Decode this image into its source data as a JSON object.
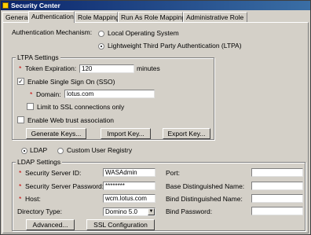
{
  "window": {
    "title": "Security Center"
  },
  "tabs": [
    {
      "label": "General"
    },
    {
      "label": "Authentication"
    },
    {
      "label": "Role Mapping"
    },
    {
      "label": "Run As Role Mapping"
    },
    {
      "label": "Administrative Role"
    }
  ],
  "auth": {
    "label": "Authentication Mechanism:",
    "options": [
      {
        "label": "Local Operating System",
        "selected": false
      },
      {
        "label": "Lightweight Third Party Authentication (LTPA)",
        "selected": true
      }
    ]
  },
  "ltpa": {
    "title": "LTPA Settings",
    "token_label": "Token Expiration:",
    "token_value": "120",
    "token_unit": "minutes",
    "sso_label": "Enable Single Sign On (SSO)",
    "sso_checked": true,
    "domain_label": "Domain:",
    "domain_value": "lotus.com",
    "ssl_label": "Limit to SSL connections only",
    "ssl_checked": false,
    "webtrust_label": "Enable Web trust association",
    "webtrust_checked": false,
    "buttons": {
      "generate": "Generate Keys...",
      "import": "Import Key...",
      "export": "Export Key..."
    }
  },
  "registry": {
    "options": [
      {
        "label": "LDAP",
        "selected": true
      },
      {
        "label": "Custom User Registry",
        "selected": false
      }
    ]
  },
  "ldap": {
    "title": "LDAP Settings",
    "server_id_label": "Security Server ID:",
    "server_id_value": "WASAdmin",
    "password_label": "Security Server Password:",
    "password_value": "********",
    "host_label": "Host:",
    "host_value": "wcm.lotus.com",
    "dirtype_label": "Directory Type:",
    "dirtype_value": "Domino 5.0",
    "port_label": "Port:",
    "port_value": "",
    "base_dn_label": "Base Distinguished Name:",
    "base_dn_value": "",
    "bind_dn_label": "Bind Distinguished Name:",
    "bind_dn_value": "",
    "bind_pw_label": "Bind Password:",
    "bind_pw_value": "",
    "buttons": {
      "advanced": "Advanced...",
      "ssl_config": "SSL Configuration"
    }
  },
  "required_marker": "*"
}
